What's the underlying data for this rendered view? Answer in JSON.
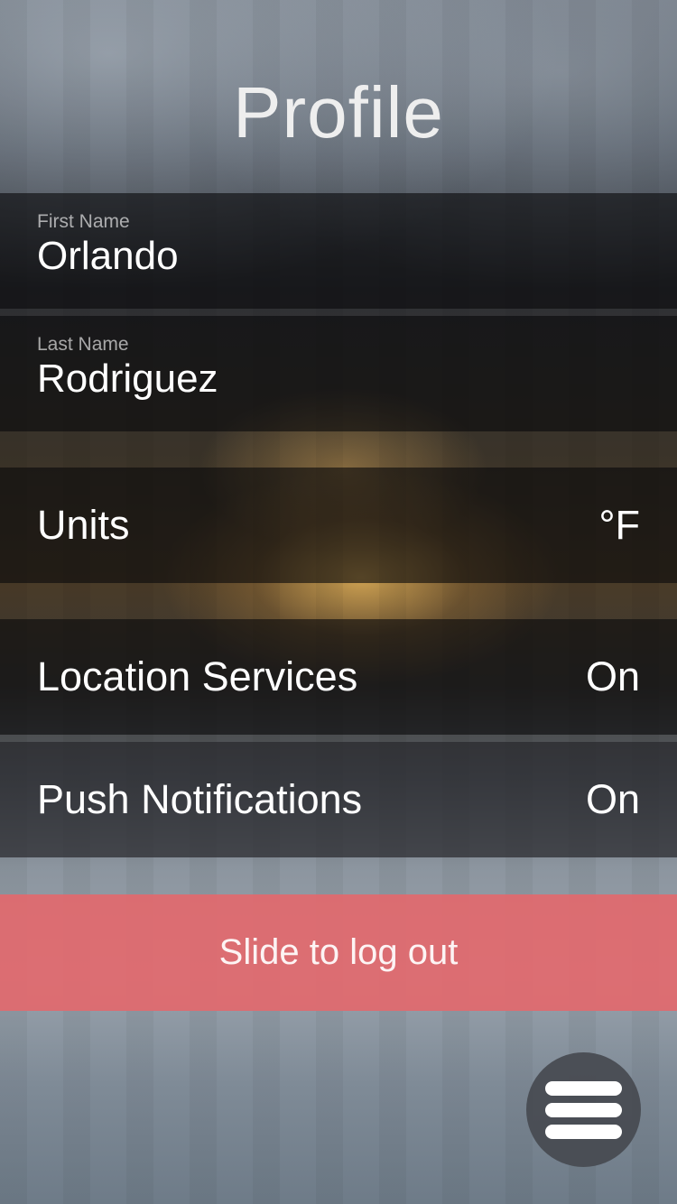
{
  "header": {
    "title": "Profile"
  },
  "profile": {
    "first_name": {
      "label": "First Name",
      "value": "Orlando"
    },
    "last_name": {
      "label": "Last Name",
      "value": "Rodriguez"
    }
  },
  "settings": [
    {
      "label": "Units",
      "value": "°F"
    },
    {
      "label": "Location Services",
      "value": "On"
    },
    {
      "label": "Push Notifications",
      "value": "On"
    }
  ],
  "logout": {
    "label": "Slide to log out"
  },
  "menu": {
    "icon": "hamburger-menu-icon"
  },
  "colors": {
    "logout_bg": "#e2696e",
    "text": "#ffffff"
  }
}
